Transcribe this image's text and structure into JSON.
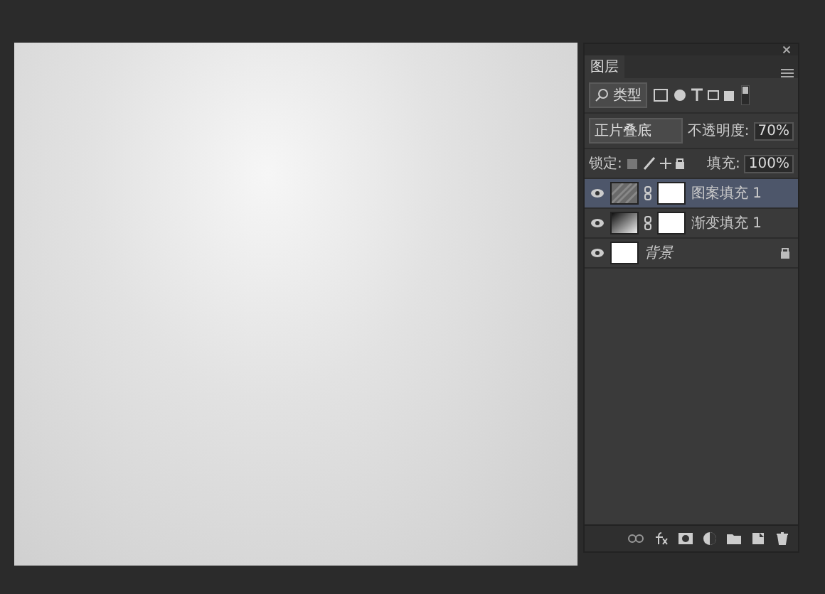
{
  "panel": {
    "title": "图层",
    "filter": {
      "label": "类型",
      "on": true
    },
    "blend_mode": "正片叠底",
    "opacity": {
      "label": "不透明度:",
      "value": "70%"
    },
    "lock": {
      "label": "锁定:"
    },
    "fill": {
      "label": "填充:",
      "value": "100%"
    },
    "layers": [
      {
        "name": "图案填充 1",
        "kind": "pattern",
        "visible": true,
        "selected": true,
        "mask": true,
        "locked": false
      },
      {
        "name": "渐变填充 1",
        "kind": "gradient",
        "visible": true,
        "selected": false,
        "mask": true,
        "locked": false
      },
      {
        "name": "背景",
        "kind": "background",
        "visible": true,
        "selected": false,
        "mask": false,
        "locked": true
      }
    ]
  }
}
